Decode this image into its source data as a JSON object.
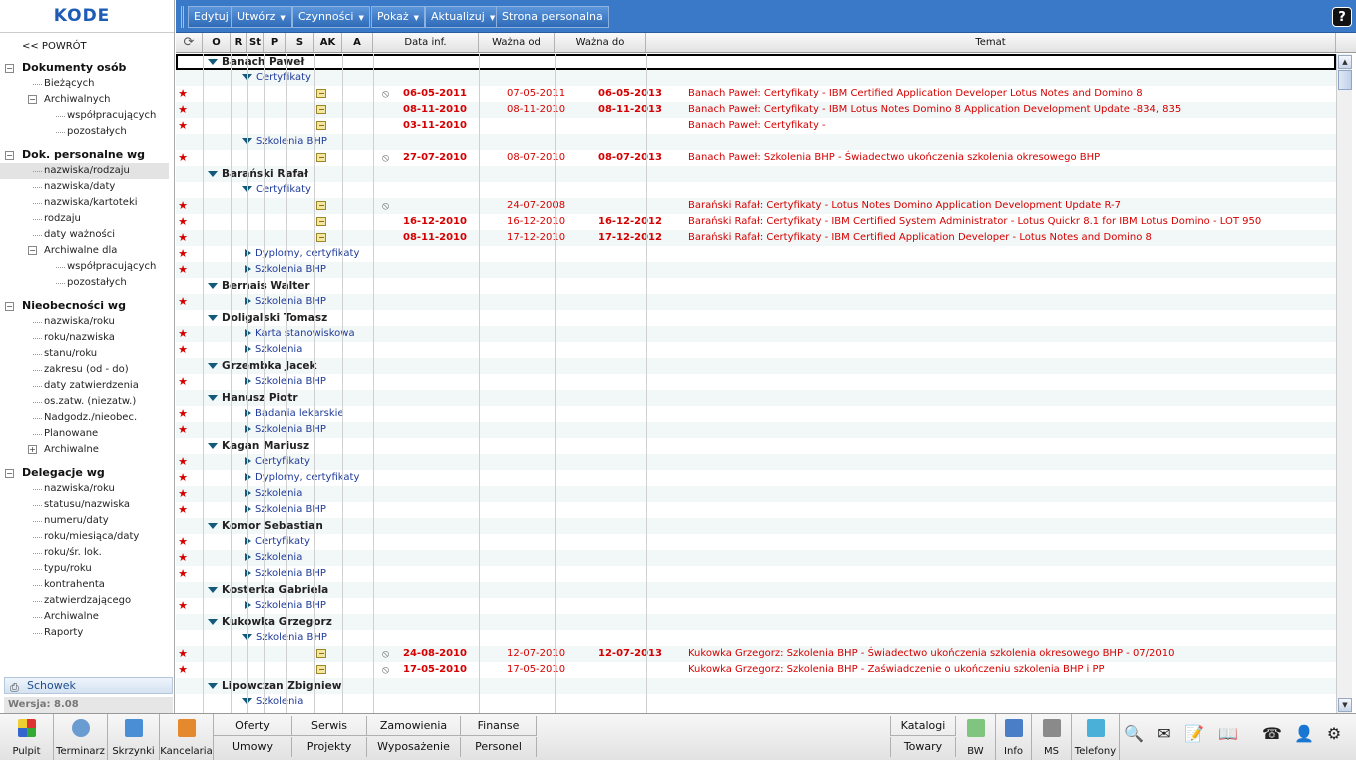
{
  "app": {
    "logo": "KODE",
    "version": "Wersja: 8.08"
  },
  "sidebar": {
    "back": "<< POWRÓT",
    "sections": [
      {
        "title": "Dokumenty osób",
        "toggle": "−",
        "items": [
          {
            "label": "Bieżących",
            "level": 1
          },
          {
            "label": "Archiwalnych",
            "level": 1,
            "toggle": "−"
          },
          {
            "label": "współpracujących",
            "level": 2
          },
          {
            "label": "pozostałych",
            "level": 2
          }
        ]
      },
      {
        "title": "Dok. personalne wg",
        "toggle": "−",
        "items": [
          {
            "label": "nazwiska/rodzaju",
            "level": 1,
            "selected": true
          },
          {
            "label": "nazwiska/daty",
            "level": 1
          },
          {
            "label": "nazwiska/kartoteki",
            "level": 1
          },
          {
            "label": "rodzaju",
            "level": 1
          },
          {
            "label": "daty ważności",
            "level": 1
          },
          {
            "label": "Archiwalne dla",
            "level": 1,
            "toggle": "−"
          },
          {
            "label": "współpracujących",
            "level": 2
          },
          {
            "label": "pozostałych",
            "level": 2
          }
        ]
      },
      {
        "title": "Nieobecności wg",
        "toggle": "−",
        "items": [
          {
            "label": "nazwiska/roku",
            "level": 1
          },
          {
            "label": "roku/nazwiska",
            "level": 1
          },
          {
            "label": "stanu/roku",
            "level": 1
          },
          {
            "label": "zakresu (od - do)",
            "level": 1
          },
          {
            "label": "daty zatwierdzenia",
            "level": 1
          },
          {
            "label": "os.zatw. (niezatw.)",
            "level": 1
          },
          {
            "label": "Nadgodz./nieobec.",
            "level": 1
          },
          {
            "label": "Planowane",
            "level": 1
          },
          {
            "label": "Archiwalne",
            "level": 1,
            "toggle": "+"
          }
        ]
      },
      {
        "title": "Delegacje wg",
        "toggle": "−",
        "items": [
          {
            "label": "nazwiska/roku",
            "level": 1
          },
          {
            "label": "statusu/nazwiska",
            "level": 1
          },
          {
            "label": "numeru/daty",
            "level": 1
          },
          {
            "label": "roku/miesiąca/daty",
            "level": 1
          },
          {
            "label": "roku/śr. lok.",
            "level": 1
          },
          {
            "label": "typu/roku",
            "level": 1
          },
          {
            "label": "kontrahenta",
            "level": 1
          },
          {
            "label": "zatwierdzającego",
            "level": 1
          },
          {
            "label": "Archiwalne",
            "level": 1
          },
          {
            "label": "Raporty",
            "level": 1
          }
        ]
      }
    ],
    "clipboard": "Schowek"
  },
  "toolbar": {
    "buttons": [
      {
        "label": "Edytuj",
        "dropdown": false
      },
      {
        "label": "Utwórz",
        "dropdown": true
      },
      {
        "label": "Czynności",
        "dropdown": true
      },
      {
        "label": "Pokaż",
        "dropdown": true
      },
      {
        "label": "Aktualizuj",
        "dropdown": true
      },
      {
        "label": "Strona personalna",
        "dropdown": false
      }
    ],
    "help": "?"
  },
  "grid": {
    "columns": [
      "O",
      "R",
      "St",
      "P",
      "S",
      "AK",
      "A",
      "Data inf.",
      "Ważna od",
      "Ważna do",
      "Temat"
    ],
    "rows": [
      {
        "t": "g1",
        "text": "Banach Paweł",
        "sel": true
      },
      {
        "t": "g2",
        "text": "Certyfikaty",
        "open": true
      },
      {
        "t": "d",
        "star": true,
        "note": true,
        "clip": true,
        "dinf": "06-05-2011",
        "od": "07-05-2011",
        "do": "06-05-2013",
        "tem": "Banach Paweł: Certyfikaty - IBM Certified Application Developer Lotus Notes and Domino 8"
      },
      {
        "t": "d",
        "star": true,
        "note": true,
        "clip": false,
        "dinf": "08-11-2010",
        "od": "08-11-2010",
        "do": "08-11-2013",
        "tem": "Banach Paweł: Certyfikaty - IBM Lotus Notes Domino 8 Application Development Update -834, 835"
      },
      {
        "t": "d",
        "star": true,
        "note": true,
        "clip": false,
        "dinf": "03-11-2010",
        "od": "",
        "do": "",
        "tem": "Banach Paweł: Certyfikaty -"
      },
      {
        "t": "g2",
        "text": "Szkolenia BHP",
        "open": true
      },
      {
        "t": "d",
        "star": true,
        "note": true,
        "clip": true,
        "dinf": "27-07-2010",
        "od": "08-07-2010",
        "do": "08-07-2013",
        "tem": "Banach Paweł: Szkolenia BHP - Świadectwo ukończenia szkolenia okresowego BHP"
      },
      {
        "t": "g1",
        "text": "Barański Rafał"
      },
      {
        "t": "g2",
        "text": "Certyfikaty",
        "open": true
      },
      {
        "t": "d",
        "star": true,
        "note": true,
        "clip": true,
        "dinf": "",
        "od": "24-07-2008",
        "do": "",
        "tem": "Barański Rafał: Certyfikaty - Lotus Notes Domino Application Development Update R-7"
      },
      {
        "t": "d",
        "star": true,
        "note": true,
        "clip": false,
        "dinf": "16-12-2010",
        "od": "16-12-2010",
        "do": "16-12-2012",
        "tem": "Barański Rafał: Certyfikaty - IBM Certified System Administrator - Lotus Quickr 8.1 for IBM Lotus Domino - LOT 950"
      },
      {
        "t": "d",
        "star": true,
        "note": true,
        "clip": false,
        "dinf": "08-11-2010",
        "od": "17-12-2010",
        "do": "17-12-2012",
        "tem": "Barański Rafał: Certyfikaty - IBM Certified Application Developer - Lotus Notes and Domino 8"
      },
      {
        "t": "g2",
        "text": "Dyplomy, certyfikaty",
        "star": true
      },
      {
        "t": "g2",
        "text": "Szkolenia BHP",
        "star": true
      },
      {
        "t": "g1",
        "text": "Bernais Walter"
      },
      {
        "t": "g2",
        "text": "Szkolenia BHP",
        "star": true
      },
      {
        "t": "g1",
        "text": "Doligalski Tomasz"
      },
      {
        "t": "g2",
        "text": "Karta stanowiskowa",
        "star": true
      },
      {
        "t": "g2",
        "text": "Szkolenia",
        "star": true
      },
      {
        "t": "g1",
        "text": "Grzembka Jacek"
      },
      {
        "t": "g2",
        "text": "Szkolenia BHP",
        "star": true
      },
      {
        "t": "g1",
        "text": "Hanusz Piotr"
      },
      {
        "t": "g2",
        "text": "Badania lekarskie",
        "star": true
      },
      {
        "t": "g2",
        "text": "Szkolenia BHP",
        "star": true
      },
      {
        "t": "g1",
        "text": "Kagan Mariusz"
      },
      {
        "t": "g2",
        "text": "Certyfikaty",
        "star": true
      },
      {
        "t": "g2",
        "text": "Dyplomy, certyfikaty",
        "star": true
      },
      {
        "t": "g2",
        "text": "Szkolenia",
        "star": true
      },
      {
        "t": "g2",
        "text": "Szkolenia BHP",
        "star": true
      },
      {
        "t": "g1",
        "text": "Komor Sebastian"
      },
      {
        "t": "g2",
        "text": "Certyfikaty",
        "star": true
      },
      {
        "t": "g2",
        "text": "Szkolenia",
        "star": true
      },
      {
        "t": "g2",
        "text": "Szkolenia BHP",
        "star": true
      },
      {
        "t": "g1",
        "text": "Kosterka Gabriela"
      },
      {
        "t": "g2",
        "text": "Szkolenia BHP",
        "star": true
      },
      {
        "t": "g1",
        "text": "Kukowka Grzegorz"
      },
      {
        "t": "g2",
        "text": "Szkolenia BHP",
        "open": true
      },
      {
        "t": "d",
        "star": true,
        "note": true,
        "clip": true,
        "dinf": "24-08-2010",
        "od": "12-07-2010",
        "do": "12-07-2013",
        "tem": "Kukowka Grzegorz: Szkolenia BHP - Świadectwo ukończenia szkolenia okresowego BHP - 07/2010"
      },
      {
        "t": "d",
        "star": true,
        "note": true,
        "clip": true,
        "dinf": "17-05-2010",
        "od": "17-05-2010",
        "do": "",
        "tem": "Kukowka Grzegorz: Szkolenia BHP - Zaświadczenie o ukończeniu szkolenia BHP i PP"
      },
      {
        "t": "g1",
        "text": "Lipowczan Zbigniew"
      },
      {
        "t": "g2",
        "text": "Szkolenia",
        "open": true
      }
    ]
  },
  "bottombar": {
    "apps": [
      {
        "label": "Pulpit",
        "icon": "pulpit-icon"
      },
      {
        "label": "Terminarz",
        "icon": "terminarz-icon"
      },
      {
        "label": "Skrzynki",
        "icon": "skrzynki-icon"
      },
      {
        "label": "Kancelaria",
        "icon": "kancelaria-icon"
      }
    ],
    "links_row1": [
      "Oferty",
      "Serwis",
      "Zamowienia",
      "Finanse"
    ],
    "links_row2": [
      "Umowy",
      "Projekty",
      "Wyposażenie",
      "Personel"
    ],
    "katalogi": "Katalogi",
    "towary": "Towary",
    "right_apps": [
      {
        "label": "BW",
        "icon": "bw-icon"
      },
      {
        "label": "Info",
        "icon": "info-icon"
      },
      {
        "label": "MS",
        "icon": "ms-icon"
      },
      {
        "label": "Telefony",
        "icon": "telefony-icon"
      }
    ],
    "tools": [
      "search-icon",
      "mail-icon",
      "notes-icon",
      "book-search-icon",
      "phone-icon",
      "user-icon",
      "settings-icon"
    ]
  }
}
